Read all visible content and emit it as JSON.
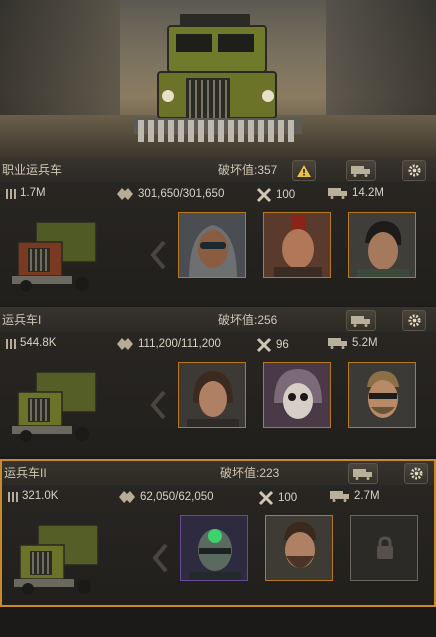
{
  "colors": {
    "accent": "#c98a2c",
    "panel": "#26231f",
    "text": "#cfc6b4"
  },
  "icons": {
    "ammo": "ammo-icon",
    "armor": "armor-shield-icon",
    "repair": "wrench-hammer-icon",
    "cargo": "truck-cargo-icon",
    "alert": "warning-triangle-icon",
    "settings": "gear-icon",
    "lock": "lock-icon"
  },
  "vehicles": [
    {
      "name": "职业运兵车",
      "damage": "破坏值:357",
      "ammo": "1.7M",
      "armor": "301,650/301,650",
      "repair": "100",
      "cargo": "14.2M",
      "warning": true,
      "selected": false,
      "crew": [
        {
          "name": "crew-hood-sunglasses"
        },
        {
          "name": "crew-mohawk"
        },
        {
          "name": "crew-dark-hair"
        }
      ]
    },
    {
      "name": "运兵车I",
      "damage": "破坏值:256",
      "ammo": "544.8K",
      "armor": "111,200/111,200",
      "repair": "96",
      "cargo": "5.2M",
      "warning": false,
      "selected": false,
      "crew": [
        {
          "name": "crew-long-hair"
        },
        {
          "name": "crew-skull-mask"
        },
        {
          "name": "crew-bearded-glasses"
        }
      ]
    },
    {
      "name": "运兵车II",
      "damage": "破坏值:223",
      "ammo": "321.0K",
      "armor": "62,050/62,050",
      "repair": "100",
      "cargo": "2.7M",
      "warning": false,
      "selected": true,
      "crew": [
        {
          "name": "crew-cyborg-green"
        },
        {
          "name": "crew-bearded"
        },
        {
          "name": "locked-slot"
        }
      ]
    }
  ]
}
